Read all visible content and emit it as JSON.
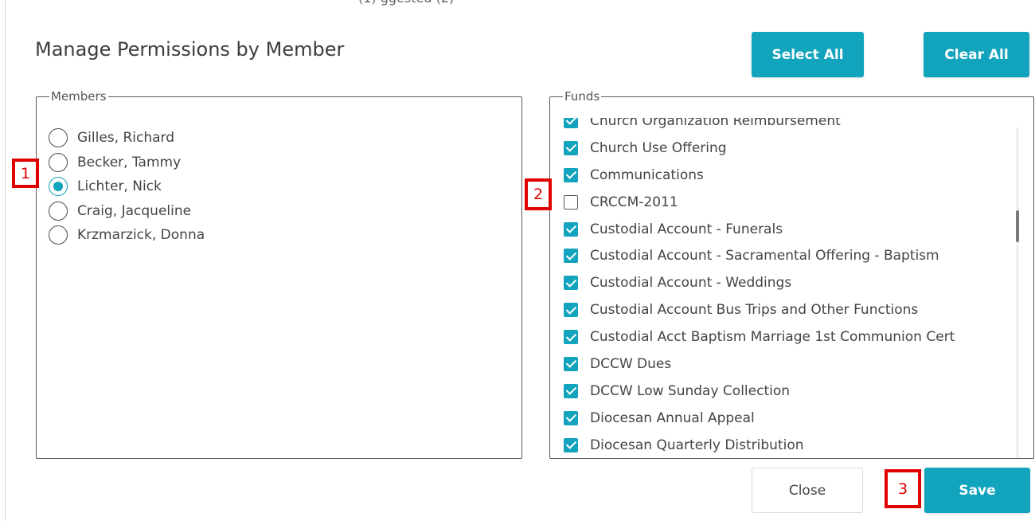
{
  "header": {
    "top_cut_text": "(1)                                                  ggested (2)"
  },
  "dialog": {
    "title": "Manage Permissions by Member",
    "select_all_label": "Select All",
    "clear_all_label": "Clear All",
    "close_label": "Close",
    "save_label": "Save"
  },
  "members": {
    "legend": "Members",
    "items": [
      {
        "name": "Gilles, Richard",
        "selected": false
      },
      {
        "name": "Becker, Tammy",
        "selected": false
      },
      {
        "name": "Lichter, Nick",
        "selected": true
      },
      {
        "name": "Craig, Jacqueline",
        "selected": false
      },
      {
        "name": "Krzmarzick, Donna",
        "selected": false
      }
    ]
  },
  "funds": {
    "legend": "Funds",
    "items": [
      {
        "name": "Church Organization Reimbursement",
        "checked": true
      },
      {
        "name": "Church Use Offering",
        "checked": true
      },
      {
        "name": "Communications",
        "checked": true
      },
      {
        "name": "CRCCM-2011",
        "checked": false
      },
      {
        "name": "Custodial Account - Funerals",
        "checked": true
      },
      {
        "name": "Custodial Account - Sacramental Offering - Baptism",
        "checked": true
      },
      {
        "name": "Custodial Account - Weddings",
        "checked": true
      },
      {
        "name": "Custodial Account Bus Trips and Other Functions",
        "checked": true
      },
      {
        "name": "Custodial Acct Baptism Marriage 1st Communion Cert",
        "checked": true
      },
      {
        "name": "DCCW Dues",
        "checked": true
      },
      {
        "name": "DCCW Low Sunday Collection",
        "checked": true
      },
      {
        "name": "Diocesan Annual Appeal",
        "checked": true
      },
      {
        "name": "Diocesan Quarterly Distribution",
        "checked": true
      }
    ]
  },
  "annotations": {
    "marker_1": "1",
    "marker_2": "2",
    "marker_3": "3"
  },
  "colors": {
    "accent": "#12a3bd",
    "marker": "#e00000"
  }
}
